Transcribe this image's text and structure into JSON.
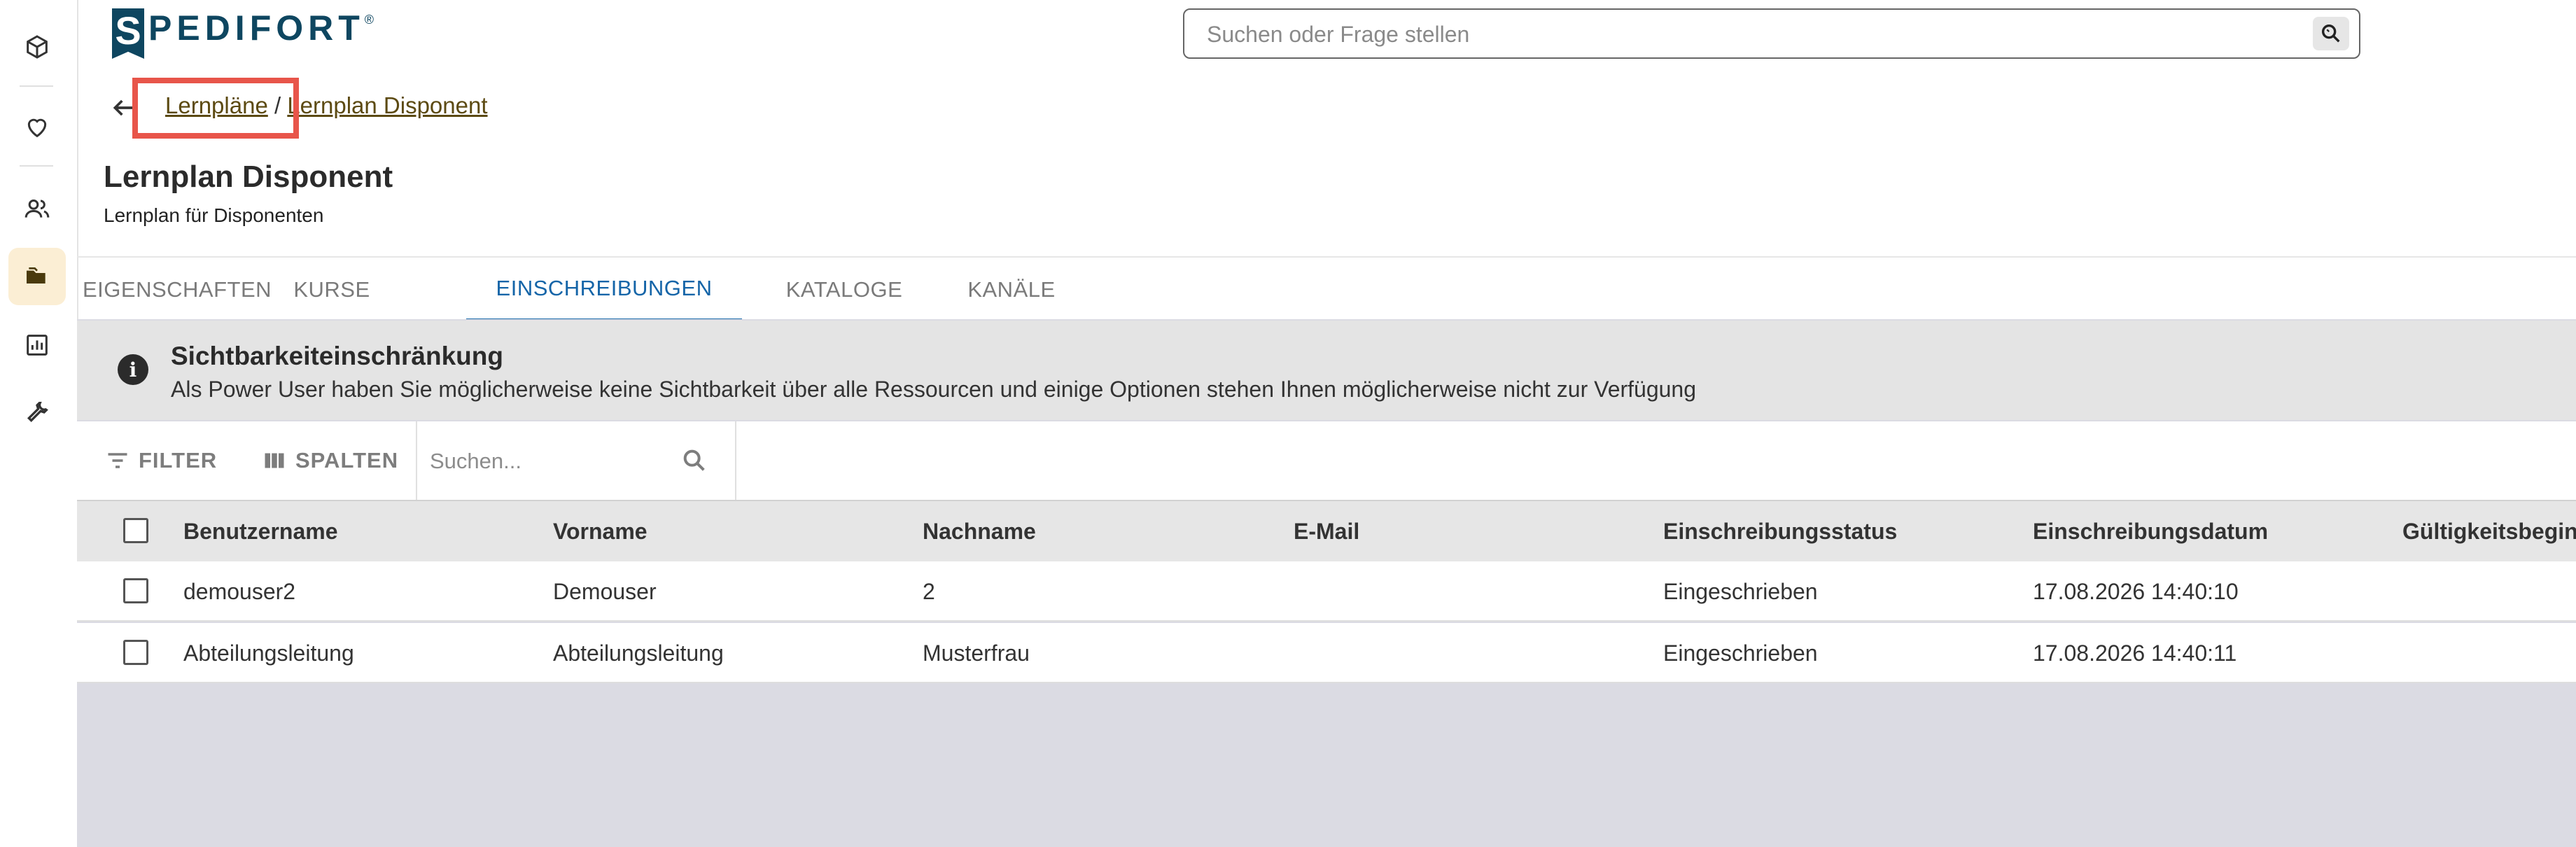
{
  "brand": {
    "logo_letter": "S",
    "logo_rest": "PEDIFORT",
    "logo_mark": "®"
  },
  "rail": {
    "items": [
      {
        "name": "cube-icon"
      },
      {
        "name": "heart-icon"
      },
      {
        "name": "users-icon"
      },
      {
        "name": "folder-icon",
        "active": true
      },
      {
        "name": "chart-icon"
      },
      {
        "name": "wrench-icon"
      }
    ]
  },
  "global_search": {
    "placeholder": "Suchen oder Frage stellen"
  },
  "breadcrumb": {
    "items": [
      "Lernpläne",
      "Lernplan Disponent"
    ],
    "separator": "/"
  },
  "page": {
    "title": "Lernplan Disponent",
    "subtitle": "Lernplan für Disponenten"
  },
  "tabs": [
    {
      "label": "EIGENSCHAFTEN"
    },
    {
      "label": "KURSE"
    },
    {
      "label": "EINSCHREIBUNGEN",
      "active": true
    },
    {
      "label": "KATALOGE"
    },
    {
      "label": "KANÄLE"
    }
  ],
  "notice": {
    "title": "Sichtbarkeiteinschränkung",
    "text": "Als Power User haben Sie möglicherweise keine Sichtbarkeit über alle Ressourcen und einige Optionen stehen Ihnen möglicherweise nicht zur Verfügung"
  },
  "toolbar": {
    "filter_label": "FILTER",
    "columns_label": "SPALTEN",
    "search_placeholder": "Suchen..."
  },
  "table": {
    "columns": [
      "Benutzername",
      "Vorname",
      "Nachname",
      "E-Mail",
      "Einschreibungsstatus",
      "Einschreibungsdatum",
      "Gültigkeitsbeginn"
    ],
    "rows": [
      [
        "demouser2",
        "Demouser",
        "2",
        "",
        "Eingeschrieben",
        "17.08.2026 14:40:10",
        ""
      ],
      [
        "Abteilungsleitung",
        "Abteilungsleitung",
        "Musterfrau",
        "",
        "Eingeschrieben",
        "17.08.2026 14:40:11",
        ""
      ]
    ]
  },
  "colors": {
    "accent": "#1565a8",
    "brand": "#0e4660",
    "highlight": "#e8554a",
    "breadcrumb_link": "#5c4a12"
  }
}
